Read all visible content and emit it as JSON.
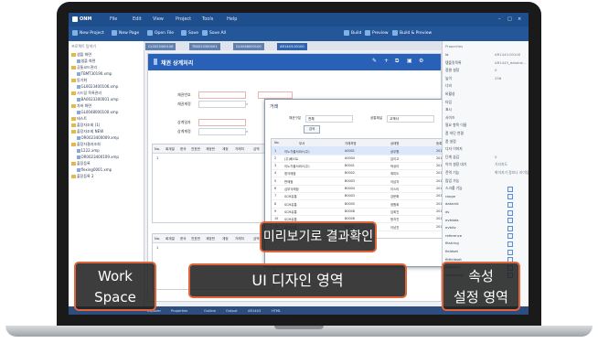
{
  "app": {
    "logo": "ONM",
    "menu": [
      "File",
      "Edit",
      "View",
      "Project",
      "Tools",
      "Help"
    ],
    "toolbar": [
      "New Project",
      "New Page",
      "Open File",
      "Save",
      "Save All",
      "Build",
      "Preview",
      "Build & Preview"
    ]
  },
  "left_panel": {
    "title": "프로젝트 탐색기",
    "items": [
      "샘플 화면",
      "샘플 화면",
      "공통코드관리",
      "TBMT30190.xmp",
      "동기화",
      "GL0023400106.xmp",
      "시드링 목록관리",
      "BA0023300001.xmp",
      "자바 화면",
      "GL0048000100.xmp",
      "테스트",
      "출장자조회 (1)",
      "출장자조회 NEW",
      "OR0023400009.xmp",
      "출장자결과조회",
      "1222.xmp",
      "OR0023400109.xmp",
      "출장등록",
      "flexing0001.xmp",
      "출장등록 2"
    ]
  },
  "editor": {
    "tabs": [
      "CL0023400106",
      "TB0023300001",
      "GL0048000100",
      "AR1443.00100"
    ],
    "title": "채권 상계처리",
    "labels": [
      "채권번호",
      "채권계정",
      "상계일자",
      "상계계정"
    ],
    "grid_columns": [
      "No.",
      "회계일",
      "한국",
      "전표번",
      "계정번",
      "계정",
      "거래처",
      "금액"
    ],
    "grid_sample_row": "1"
  },
  "dialog": {
    "title": "거래",
    "filter1_label": "채권구분",
    "filter1_value": "전체",
    "filter2_label": "공통채널",
    "filter2_value": "고객사",
    "search_button": "검색",
    "columns": [
      "No.",
      "부서",
      "거래처명",
      "상태명",
      "등록일"
    ],
    "rows": [
      [
        "1",
        "이노가을서비스(주)",
        "A0001",
        "상무원",
        "2017-02-01"
      ],
      [
        "2",
        "(주)베스트",
        "A0004",
        "김이고",
        "2017-02-01"
      ],
      [
        "3",
        "이노가을서비스(주)",
        "B0001",
        "박상아",
        "2017-02-01"
      ],
      [
        "4",
        "청각매점",
        "B0002",
        "최미도",
        "2017-02-01"
      ],
      [
        "5",
        "판매점",
        "B0003",
        "이남자",
        "2017-02-01"
      ],
      [
        "6",
        "심부식매점",
        "B0004",
        "이스티",
        "2017-02-01"
      ],
      [
        "7",
        "SCM유통",
        "B0003",
        "강문확",
        "2017-02-01"
      ],
      [
        "8",
        "SCM유통",
        "B0005",
        "정원희",
        "2017-02-01"
      ],
      [
        "9",
        "SCM유통",
        "B0008",
        "임희진",
        "2017-02-01"
      ],
      [
        "10",
        "SCM유통",
        "B0006",
        "윤자진",
        "2017-02-01"
      ],
      [
        "11",
        "SCM유통",
        "B0007",
        "이남진",
        "2017-02-01"
      ]
    ]
  },
  "right_panel": {
    "title": "Properties",
    "props": [
      [
        "id",
        "AR1443.00100"
      ],
      [
        "템플릿목록",
        "AR1443_datalist..."
      ],
      [
        "정렬 설정",
        "0"
      ],
      [
        "높이",
        "258"
      ],
      [
        "너비",
        ""
      ],
      [
        "비활성",
        ""
      ],
      [
        "타입",
        ""
      ],
      [
        "표시",
        ""
      ],
      [
        "사이즈",
        ""
      ],
      [
        "필요 항목 이름",
        ""
      ],
      [
        "폼 하단 연결",
        ""
      ],
      [
        "폼 설정",
        ""
      ],
      [
        "디자 이미지",
        ""
      ],
      [
        "단계 숨김",
        "0"
      ],
      [
        "이미 설정 대기",
        "기리지도"
      ],
      [
        "전역 기능",
        "화이지기 정보나 라이팅"
      ],
      [
        "팝업 가능",
        ""
      ],
      [
        "스크롤 기능",
        ""
      ],
      [
        "range",
        ""
      ],
      [
        "datainit",
        ""
      ],
      [
        "ds",
        ""
      ],
      [
        "evtdata",
        ""
      ],
      [
        "evtdiv",
        ""
      ],
      [
        "reference",
        ""
      ],
      [
        "fitstring",
        ""
      ],
      [
        "fieldset",
        ""
      ],
      [
        "fitfieldset",
        ""
      ],
      [
        "readonly",
        ""
      ],
      [
        "selectlang",
        ""
      ]
    ]
  },
  "status_bar": [
    "Explorer",
    "Properties",
    "Outline",
    "Output",
    "AR1443",
    "HTML"
  ],
  "callouts": {
    "preview": "미리보기로 결과확인",
    "work_space": "Work\nSpace",
    "ui_design": "UI 디자인 영역",
    "property": "속성\n설정 영역"
  },
  "colors": {
    "accent": "#2961b8",
    "callout_border": "#e0653a",
    "callout_bg": "#222222"
  }
}
